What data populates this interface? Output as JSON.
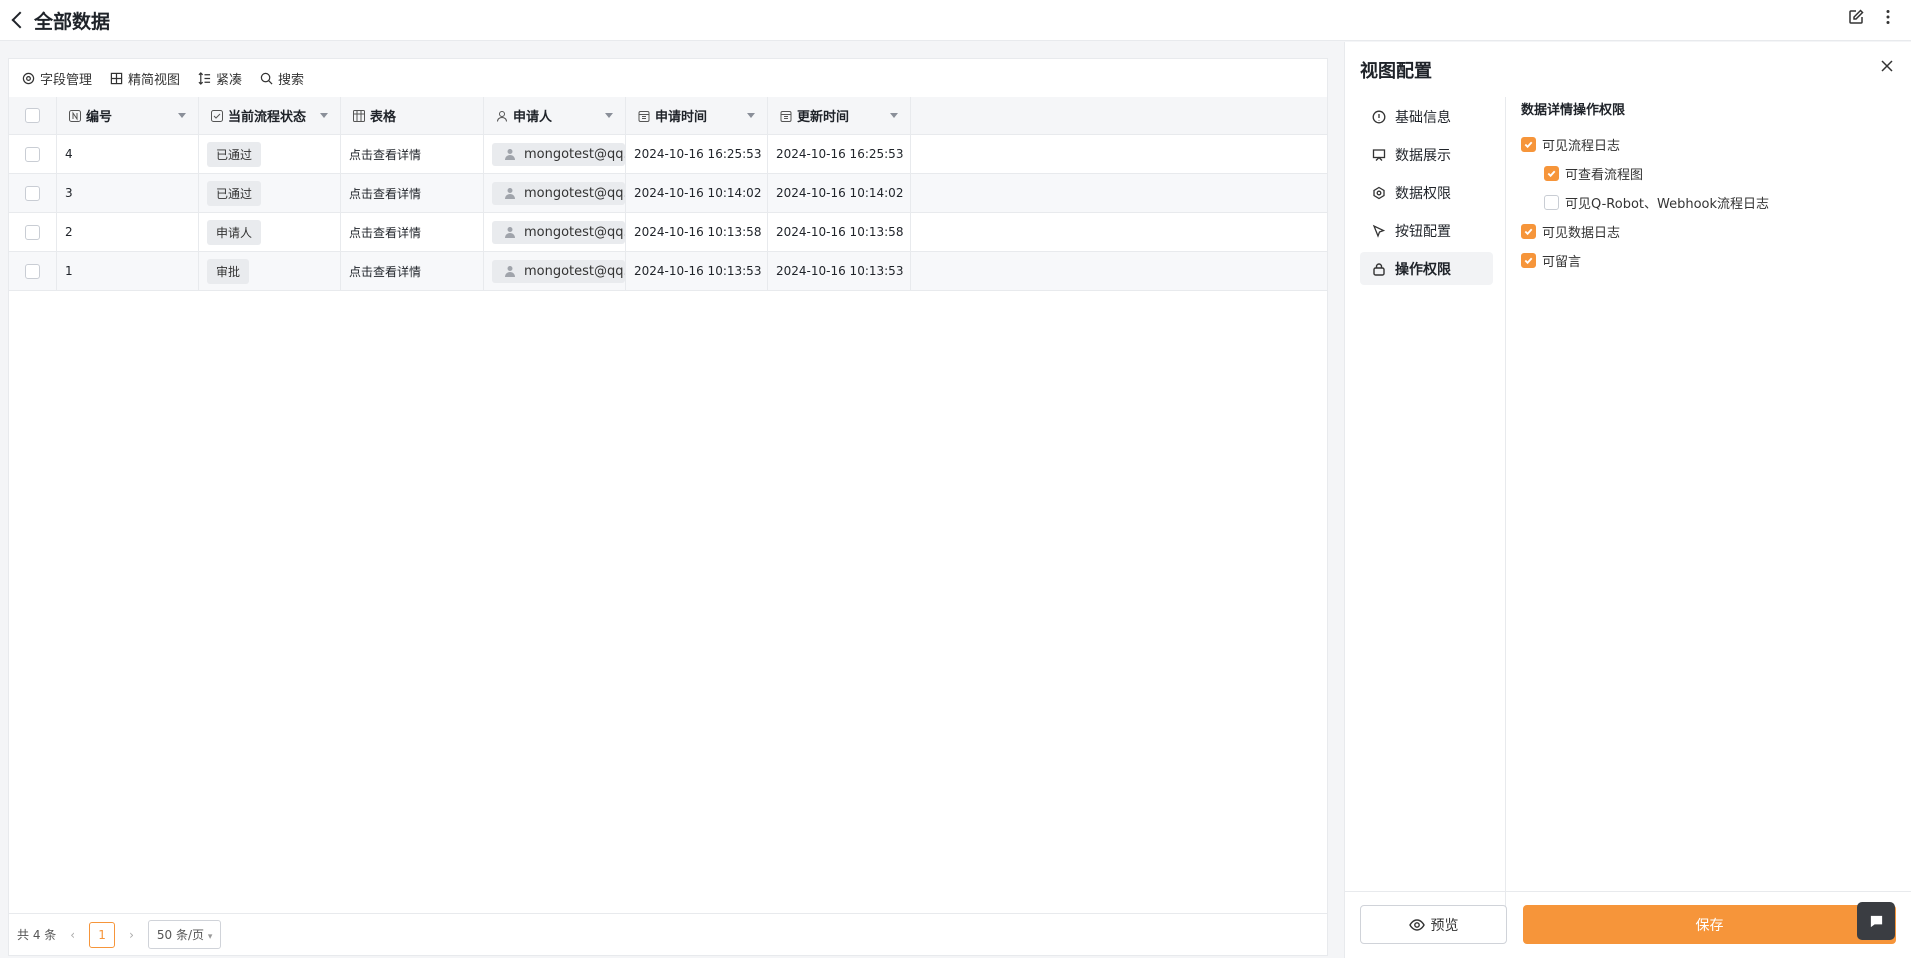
{
  "header": {
    "title": "全部数据"
  },
  "toolbar": {
    "fields": "字段管理",
    "view": "精简视图",
    "density": "紧凑",
    "search": "搜索"
  },
  "table": {
    "columns": [
      "编号",
      "当前流程状态",
      "表格",
      "申请人",
      "申请时间",
      "更新时间"
    ],
    "rows": [
      {
        "id": "4",
        "status": "已通过",
        "form": "点击查看详情",
        "applicant": "mongotest@qq.com",
        "applied": "2024-10-16 16:25:53",
        "updated": "2024-10-16 16:25:53"
      },
      {
        "id": "3",
        "status": "已通过",
        "form": "点击查看详情",
        "applicant": "mongotest@qq.com",
        "applied": "2024-10-16 10:14:02",
        "updated": "2024-10-16 10:14:02"
      },
      {
        "id": "2",
        "status": "申请人",
        "form": "点击查看详情",
        "applicant": "mongotest@qq.com",
        "applied": "2024-10-16 10:13:58",
        "updated": "2024-10-16 10:13:58"
      },
      {
        "id": "1",
        "status": "审批",
        "form": "点击查看详情",
        "applicant": "mongotest@qq.com",
        "applied": "2024-10-16 10:13:53",
        "updated": "2024-10-16 10:13:53"
      }
    ]
  },
  "footer": {
    "total": "共 4 条",
    "page": "1",
    "page_size": "50 条/页"
  },
  "config": {
    "title": "视图配置",
    "nav": [
      "基础信息",
      "数据展示",
      "数据权限",
      "按钮配置",
      "操作权限"
    ],
    "perm_title": "数据详情操作权限",
    "options": [
      {
        "label": "可见流程日志",
        "checked": true
      },
      {
        "label": "可查看流程图",
        "checked": true
      },
      {
        "label": "可见Q-Robot、Webhook流程日志",
        "checked": false
      },
      {
        "label": "可见数据日志",
        "checked": true
      },
      {
        "label": "可留言",
        "checked": true
      }
    ],
    "preview": "预览",
    "save": "保存"
  },
  "colors": {
    "accent": "#f6953a"
  }
}
